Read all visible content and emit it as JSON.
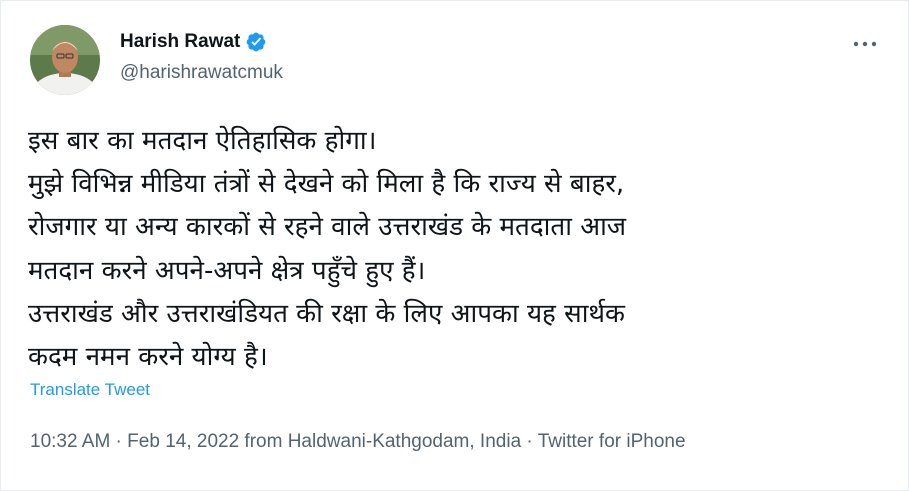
{
  "author": {
    "display_name": "Harish Rawat",
    "handle": "@harishrawatcmuk",
    "verified": true
  },
  "tweet": {
    "lines": [
      "इस बार का मतदान ऐतिहासिक होगा।",
      "मुझे विभिन्न मीडिया तंत्रों से देखने को मिला है कि राज्य से बाहर,",
      "रोजगार या अन्य कारकों से रहने वाले उत्तराखंड के मतदाता आज",
      "मतदान करने अपने-अपने क्षेत्र पहुँचे हुए हैं।",
      "उत्तराखंड और उत्तराखंडियत की रक्षा के लिए आपका यह सार्थक",
      "कदम नमन करने योग्य है।"
    ],
    "translate_label": "Translate Tweet"
  },
  "meta": {
    "time": "10:32 AM",
    "separator_1": " · ",
    "date": "Feb 14, 2022",
    "location": " from Haldwani-Kathgodam, India",
    "separator_2": " · ",
    "source": "Twitter for iPhone"
  },
  "colors": {
    "accent": "#1d9bf0",
    "secondary_text": "#536471",
    "primary_text": "#0f1419"
  },
  "icons": {
    "verified": "verified-badge-icon",
    "more": "more-horizontal-icon"
  }
}
